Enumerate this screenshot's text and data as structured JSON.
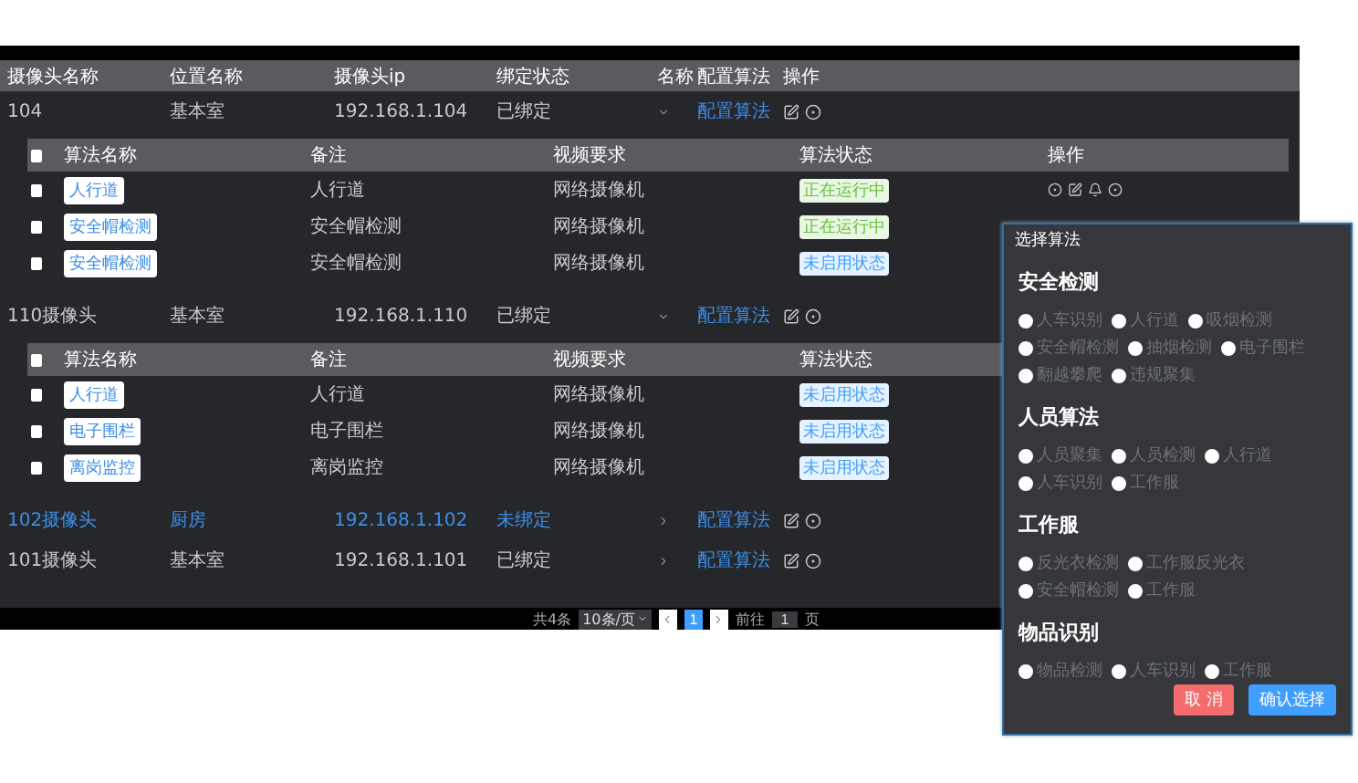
{
  "columns": [
    "摄像头名称",
    "位置名称",
    "摄像头ip",
    "绑定状态",
    "名称",
    "配置算法",
    "操作"
  ],
  "cameras": [
    {
      "name": "104",
      "location": "基本室",
      "ip": "192.168.1.104",
      "bind_status": "已绑定",
      "expanded": true,
      "selected": false,
      "config_link": "配置算法",
      "algorithm_columns": [
        "算法名称",
        "备注",
        "视频要求",
        "算法状态",
        "操作"
      ],
      "select_all_checked": false,
      "algorithms": [
        {
          "name": "人行道",
          "remark": "人行道",
          "video": "网络摄像机",
          "status": "正在运行中",
          "color": "#67c23a",
          "checked": false,
          "show_actions": true
        },
        {
          "name": "安全帽检测",
          "remark": "安全帽检测",
          "video": "网络摄像机",
          "status": "正在运行中",
          "color": "#67c23a",
          "checked": false,
          "show_actions": false
        },
        {
          "name": "安全帽检测",
          "remark": "安全帽检测",
          "video": "网络摄像机",
          "status": "未启用状态",
          "color": "#409eff",
          "checked": false,
          "show_actions": false
        }
      ]
    },
    {
      "name": "110摄像头",
      "location": "基本室",
      "ip": "192.168.1.110",
      "bind_status": "已绑定",
      "expanded": true,
      "selected": false,
      "config_link": "配置算法",
      "algorithm_columns": [
        "算法名称",
        "备注",
        "视频要求",
        "算法状态"
      ],
      "select_all_checked": false,
      "algorithms": [
        {
          "name": "人行道",
          "remark": "人行道",
          "video": "网络摄像机",
          "status": "未启用状态",
          "color": "#409eff",
          "checked": false,
          "show_actions": false
        },
        {
          "name": "电子围栏",
          "remark": "电子围栏",
          "video": "网络摄像机",
          "status": "未启用状态",
          "color": "#409eff",
          "checked": false,
          "show_actions": false
        },
        {
          "name": "离岗监控",
          "remark": "离岗监控",
          "video": "网络摄像机",
          "status": "未启用状态",
          "color": "#409eff",
          "checked": false,
          "show_actions": false
        }
      ]
    },
    {
      "name": "102摄像头",
      "location": "厨房",
      "ip": "192.168.1.102",
      "bind_status": "未绑定",
      "expanded": false,
      "selected": true,
      "config_link": "配置算法"
    },
    {
      "name": "101摄像头",
      "location": "基本室",
      "ip": "192.168.1.101",
      "bind_status": "已绑定",
      "expanded": false,
      "selected": false,
      "config_link": "配置算法"
    }
  ],
  "pagination": {
    "total": "共4条",
    "page_size": "10条/页",
    "pages": [
      {
        "label": "1",
        "selected": true
      }
    ],
    "goto_label": "前往",
    "goto_value": "1",
    "goto_unit": "页"
  },
  "dialog": {
    "title": "选择算法",
    "sections": [
      {
        "heading": "安全检测",
        "options": [
          {
            "label": "人车识别",
            "checked": false
          },
          {
            "label": "人行道",
            "checked": false
          },
          {
            "label": "吸烟检测",
            "checked": false
          },
          {
            "label": "安全帽检测",
            "checked": false
          },
          {
            "label": "抽烟检测",
            "checked": false
          },
          {
            "label": "电子围栏",
            "checked": false
          },
          {
            "label": "翻越攀爬",
            "checked": false
          },
          {
            "label": "违规聚集",
            "checked": false
          }
        ]
      },
      {
        "heading": "人员算法",
        "options": [
          {
            "label": "人员聚集",
            "checked": false
          },
          {
            "label": "人员检测",
            "checked": false
          },
          {
            "label": "人行道",
            "checked": false
          },
          {
            "label": "人车识别",
            "checked": false
          },
          {
            "label": "工作服",
            "checked": false
          }
        ]
      },
      {
        "heading": "工作服",
        "options": [
          {
            "label": "反光衣检测",
            "checked": false
          },
          {
            "label": "工作服反光衣",
            "checked": false
          },
          {
            "label": "安全帽检测",
            "checked": false
          },
          {
            "label": "工作服",
            "checked": false
          }
        ]
      },
      {
        "heading": "物品识别",
        "options": [
          {
            "label": "物品检测",
            "checked": false
          },
          {
            "label": "人车识别",
            "checked": false
          },
          {
            "label": "工作服",
            "checked": false
          }
        ]
      }
    ],
    "buttons": [
      {
        "label": "取 消",
        "kind": "cancel"
      },
      {
        "label": "确认选择",
        "kind": "confirm"
      }
    ]
  }
}
